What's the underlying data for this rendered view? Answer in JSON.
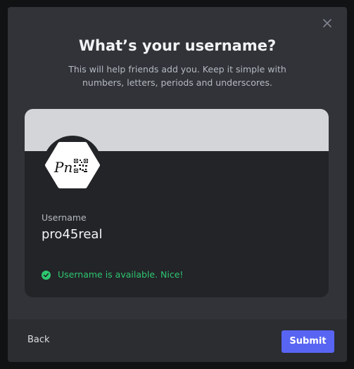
{
  "modal": {
    "title": "What’s your username?",
    "subtitle": "This will help friends add you. Keep it simple with numbers, letters, periods and underscores.",
    "close_icon": "close-icon"
  },
  "card": {
    "avatar_text": "Pn",
    "field_label": "Username",
    "username": "pro45real",
    "status_icon": "check-circle-icon",
    "status_text": "Username is available. Nice!"
  },
  "footer": {
    "back_label": "Back",
    "submit_label": "Submit"
  },
  "colors": {
    "modal_bg": "#313338",
    "card_bg": "#232428",
    "banner": "#d4d5d8",
    "accent": "#5865f2",
    "success": "#2dc770"
  }
}
